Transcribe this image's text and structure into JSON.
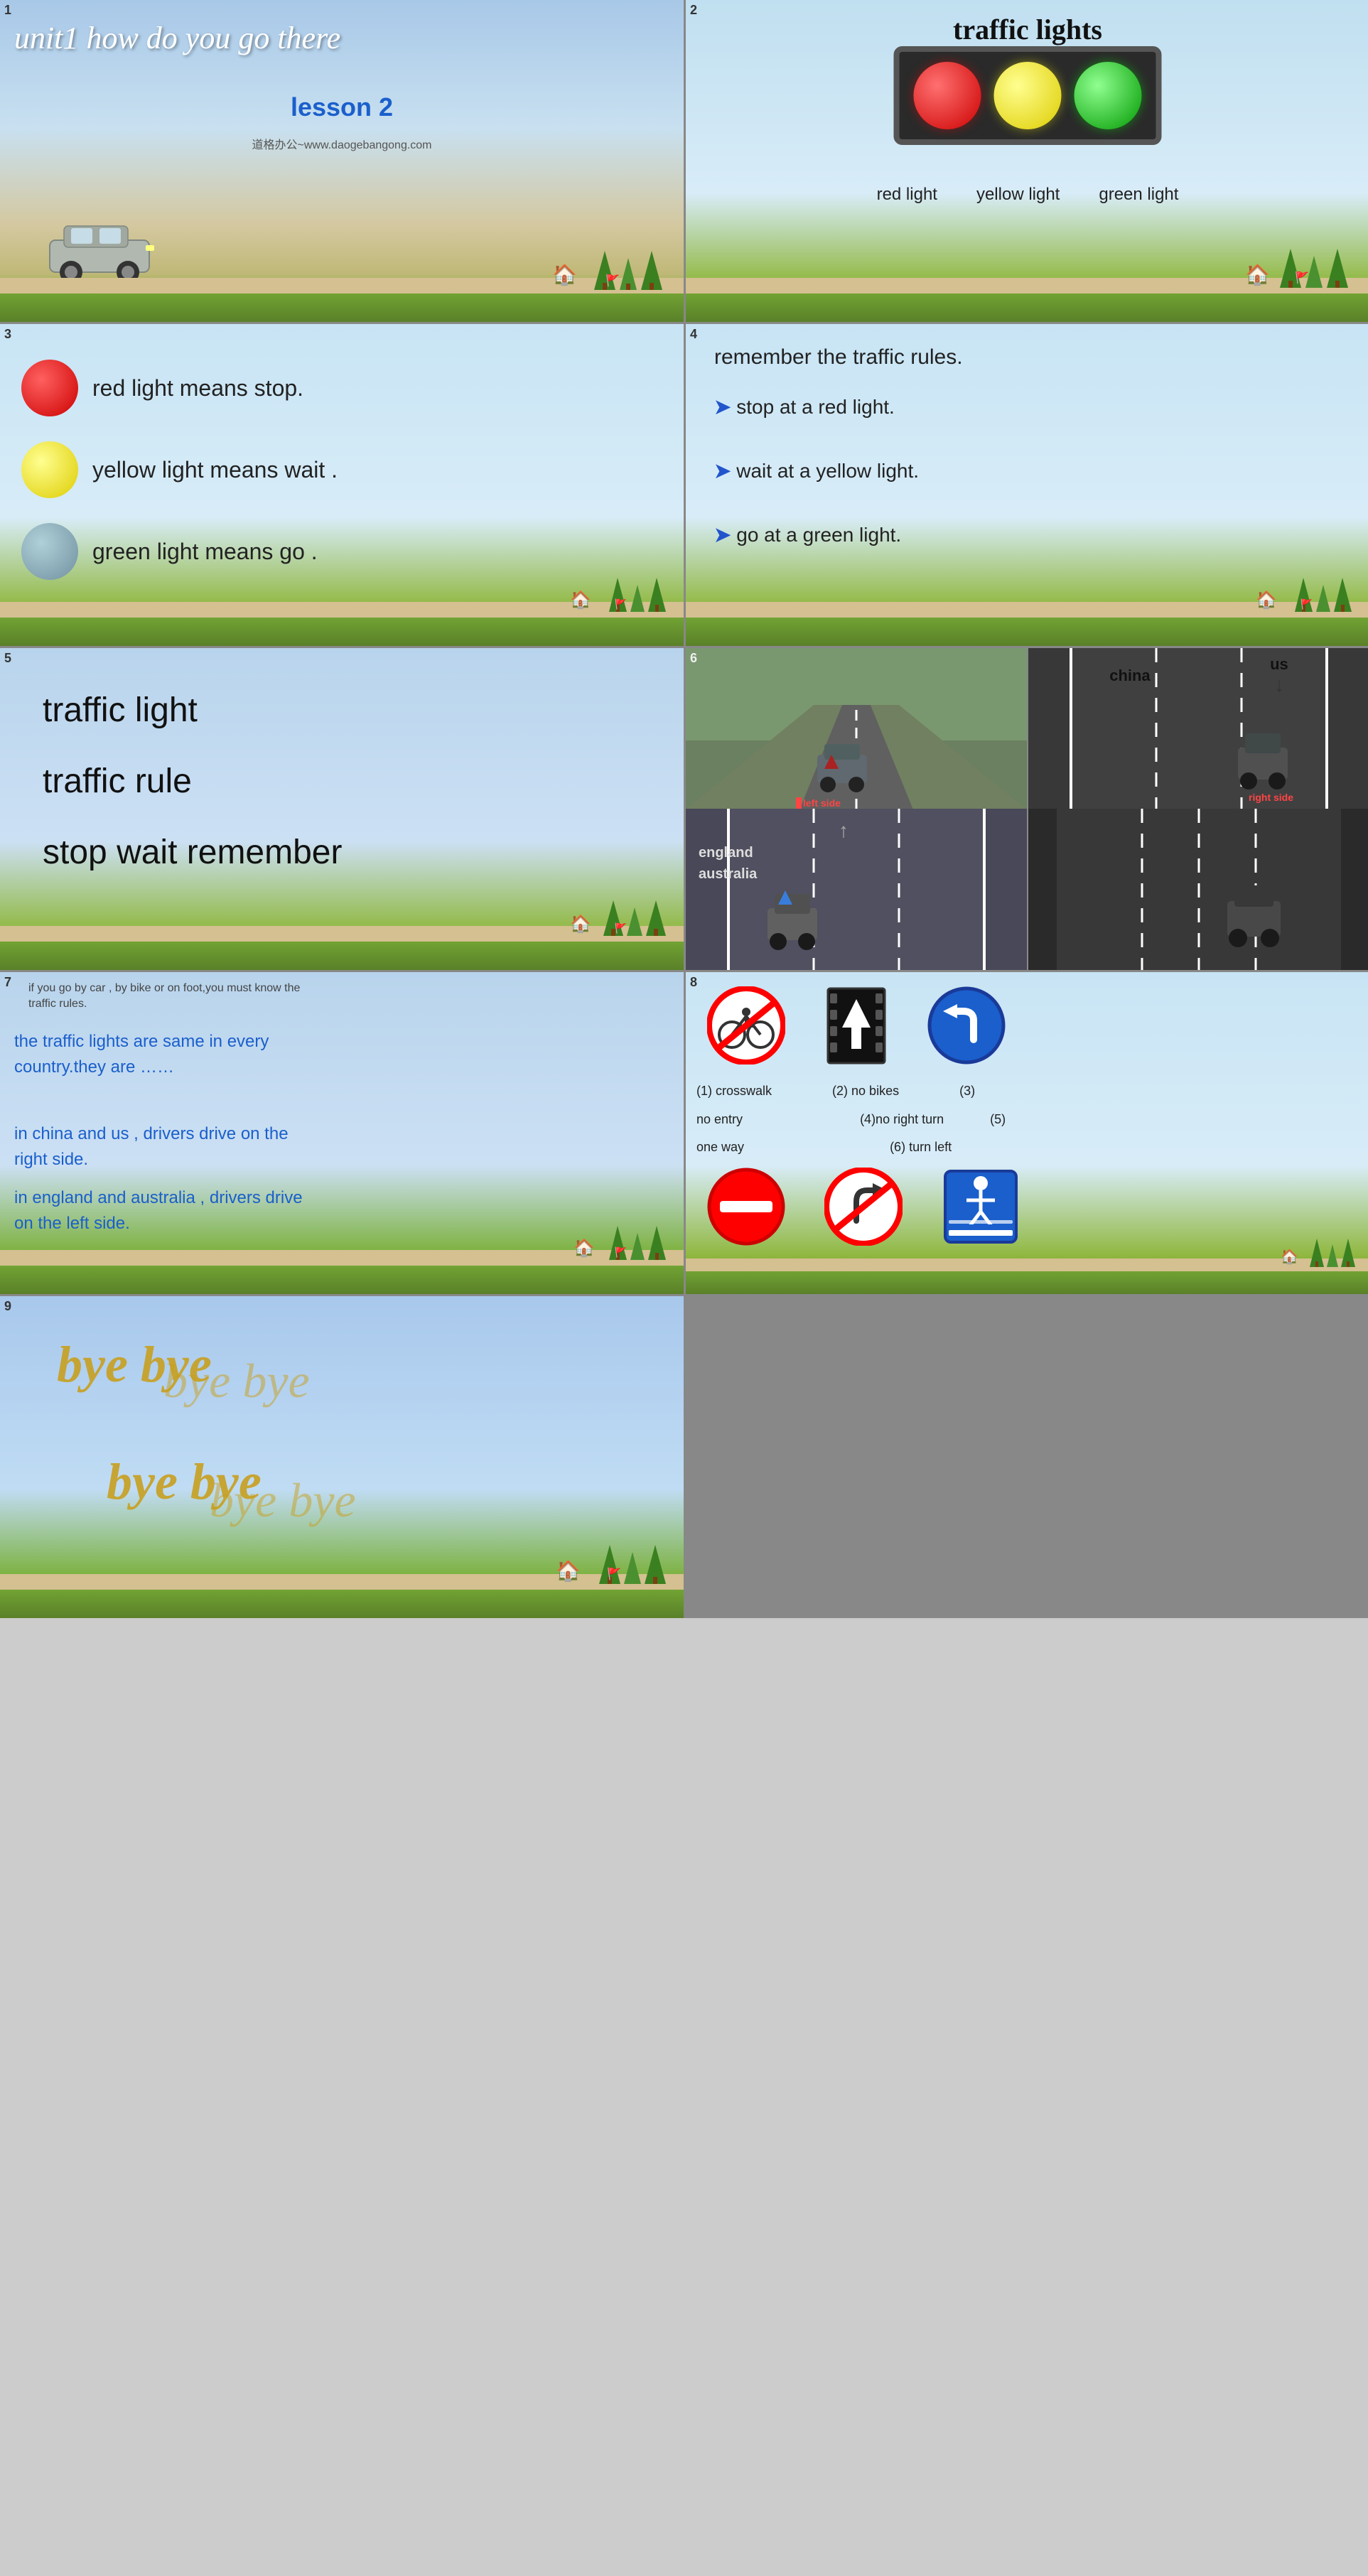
{
  "slides": [
    {
      "num": "1",
      "title": "unit1 how do you go there",
      "subtitle": "lesson 2",
      "watermark": "道格办公~www.daogebangong.com"
    },
    {
      "num": "2",
      "title": "traffic  lights",
      "label_red": "red light",
      "label_yellow": "yellow light",
      "label_green": "green light"
    },
    {
      "num": "3",
      "item1": "red light means stop.",
      "item2": "yellow light means wait .",
      "item3": "green light means go ."
    },
    {
      "num": "4",
      "head": "remember the traffic rules.",
      "rule1": "stop at a red light.",
      "rule2": "wait at a yellow light.",
      "rule3": "go at a green light."
    },
    {
      "num": "5",
      "word1": "traffic light",
      "word2": "traffic rule",
      "word3": "stop    wait    remember"
    },
    {
      "num": "6",
      "china": "china",
      "us": "us",
      "england": "england",
      "australia": "australia",
      "left_side": "left side",
      "right_side": "right side"
    },
    {
      "num": "7",
      "intro": "if you go by car , by bike or on foot,you must know the traffic rules.",
      "p1": "the traffic lights are same in every country.they are ……",
      "p2": "in china and us , drivers drive on the right side.",
      "p3": "in england and australia , drivers drive on the left side."
    },
    {
      "num": "8",
      "label1": "(1)  crosswalk",
      "label2": "(2)  no bikes",
      "label3": "(3)",
      "label4": "no entry",
      "label5": "(4)no right turn",
      "label6": "(5)",
      "label7": "one way",
      "label8": "(6)  turn left"
    },
    {
      "num": "9",
      "bye1": "bye  bye",
      "bye2": "bye  bye",
      "bye3": "bye  bye",
      "bye4": "bye  bye"
    }
  ]
}
